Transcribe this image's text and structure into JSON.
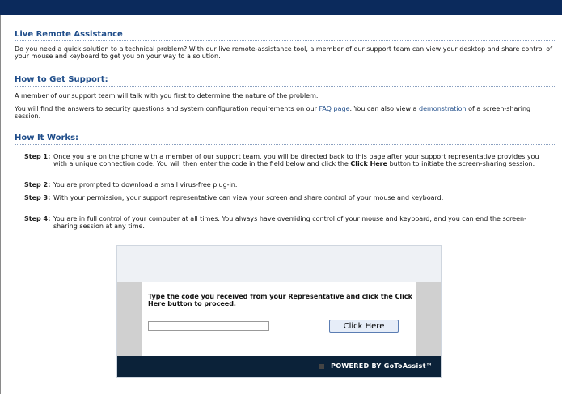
{
  "colors": {
    "topbar": "#0b2a5c",
    "heading": "#1f4d8a",
    "footer": "#0b2239"
  },
  "section1": {
    "title": "Live Remote Assistance",
    "text": "Do you need a quick solution to a technical problem? With our live remote-assistance tool, a member of our support team can view your desktop and share control of your mouse and keyboard to get you on your way to a solution."
  },
  "section2": {
    "title": "How to Get Support:",
    "p1": "A member of our support team will talk with you first to determine the nature of the problem.",
    "p2_a": "You will find the answers to security questions and system configuration requirements on our ",
    "faq_link": "FAQ page",
    "p2_b": ". You can also view a ",
    "demo_link": "demonstration",
    "p2_c": " of a screen-sharing session."
  },
  "section3": {
    "title": "How It Works:",
    "steps": [
      {
        "label": "Step 1:",
        "text_a": "Once you are on the phone with a member of our support team, you will be directed back to this page after your support representative provides you with a unique connection code. You will then enter the code in the field below and click the ",
        "bold": "Click Here",
        "text_b": " button to initiate the screen-sharing session."
      },
      {
        "label": "Step 2:",
        "text_a": "You are prompted to download a small virus-free plug-in."
      },
      {
        "label": "Step 3:",
        "text_a": "With your permission, your support representative can view your screen and share control of your mouse and keyboard."
      },
      {
        "label": "Step 4:",
        "text_a": "You are in full control of your computer at all times. You always have overriding control of your mouse and keyboard, and you can end the screen-sharing session at any time."
      }
    ]
  },
  "widget": {
    "prompt": "Type the code you received from your Representative and click the Click Here button to proceed.",
    "code_value": "",
    "button_label": "Click Here",
    "powered_prefix": "POWERED BY ",
    "powered_brand": "GoToAssist™"
  }
}
